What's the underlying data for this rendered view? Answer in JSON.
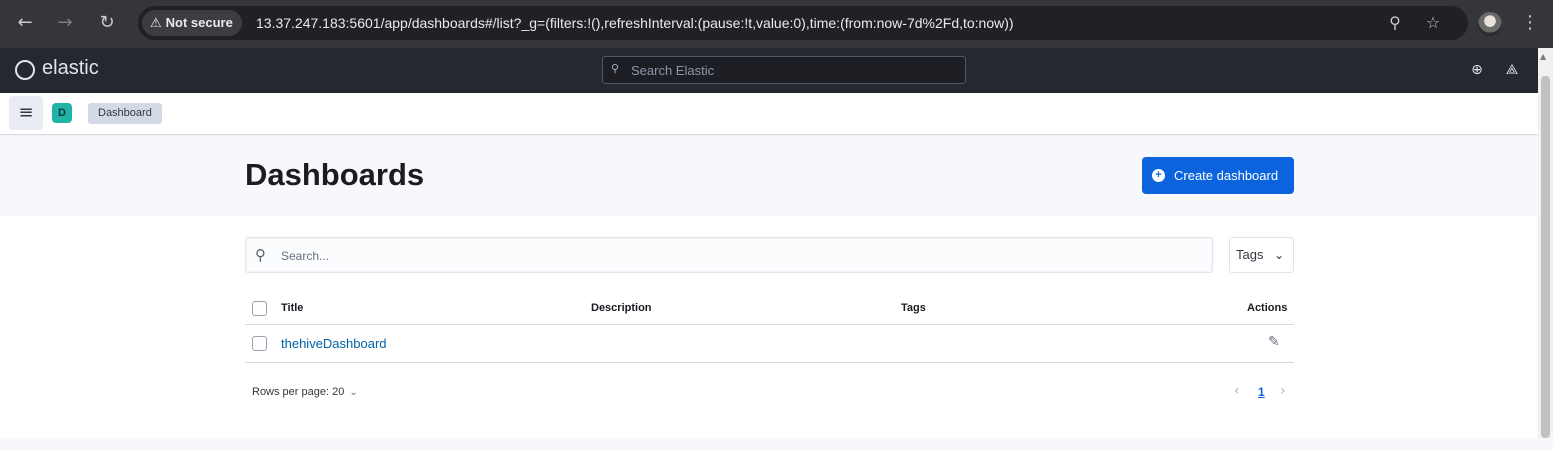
{
  "browser": {
    "security_label": "Not secure",
    "url": "13.37.247.183:5601/app/dashboards#/list?_g=(filters:!(),refreshInterval:(pause:!t,value:0),time:(from:now-7d%2Fd,to:now))",
    "icons": [
      "back-icon",
      "forward-icon",
      "reload-icon",
      "warning-icon",
      "zoom-icon",
      "star-icon",
      "profile-avatar",
      "more-vert-icon"
    ]
  },
  "header": {
    "logo_text": "elastic",
    "search_placeholder": "Search Elastic",
    "icons": [
      "help-icon",
      "notifications-icon"
    ]
  },
  "breadcrumbs": {
    "space_initial": "D",
    "items": [
      "Dashboard"
    ]
  },
  "page": {
    "title": "Dashboards",
    "create_button": "Create dashboard",
    "search_placeholder": "Search...",
    "tags_filter": "Tags"
  },
  "table": {
    "columns": [
      "Title",
      "Description",
      "Tags",
      "Actions"
    ],
    "rows": [
      {
        "title": "thehiveDashboard",
        "description": "",
        "tags": ""
      }
    ]
  },
  "pagination": {
    "rows_per_page": "Rows per page: 20",
    "current_page": "1"
  },
  "colors": {
    "primary": "#0b64dd",
    "link": "#0061a6",
    "header_bg": "#25282f",
    "space_badge": "#20b3a8"
  }
}
